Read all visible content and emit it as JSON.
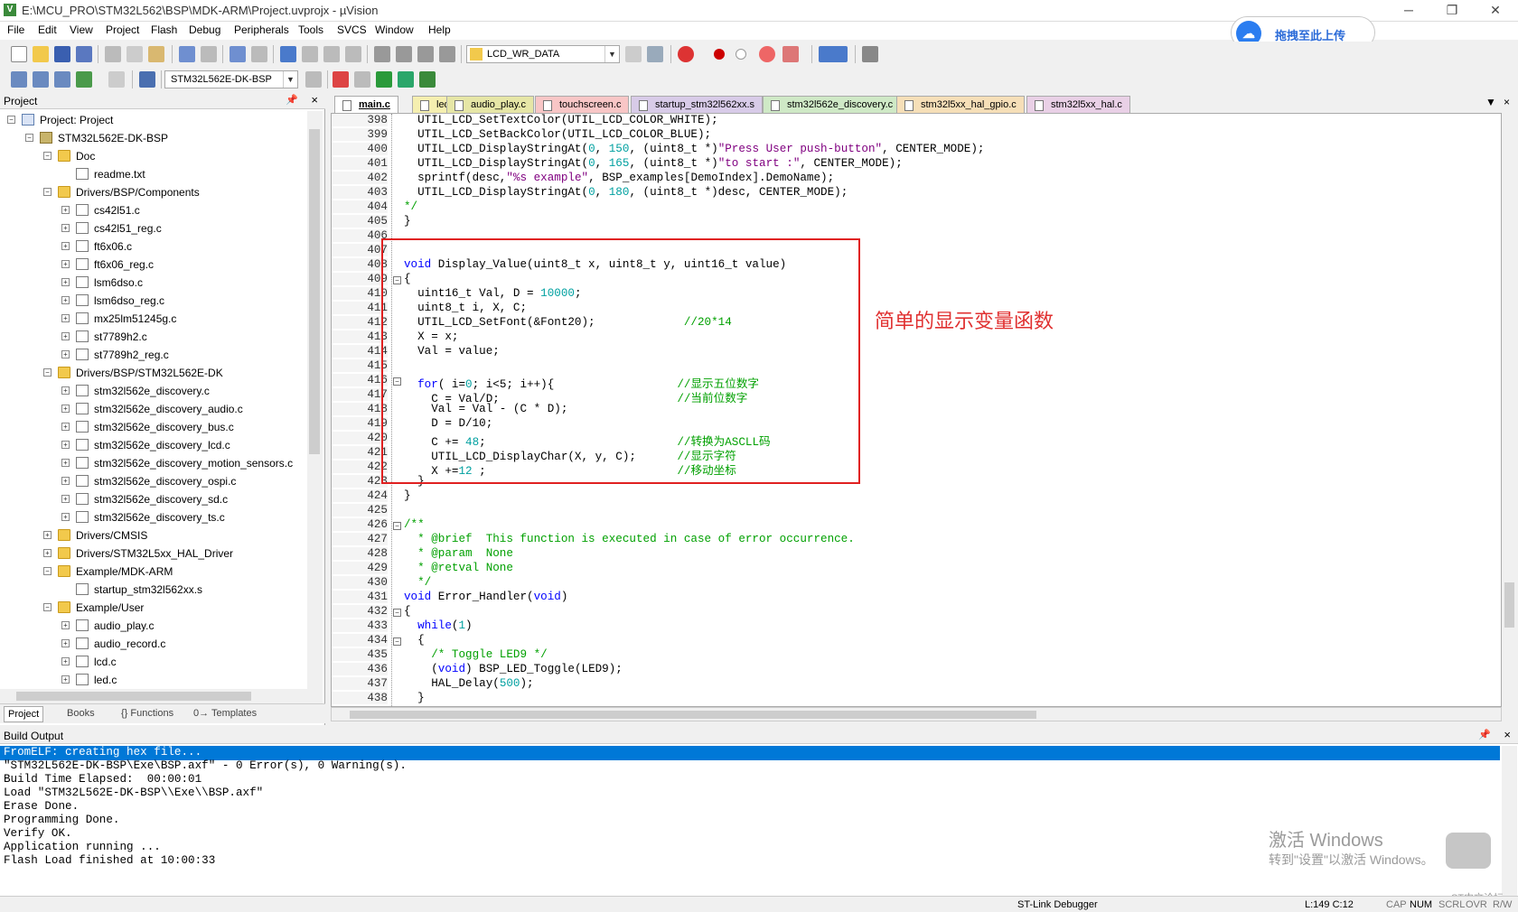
{
  "window": {
    "title": "E:\\MCU_PRO\\STM32L562\\BSP\\MDK-ARM\\Project.uvprojx - µVision",
    "icon_label": "V",
    "min": "─",
    "max": "❐",
    "close": "✕"
  },
  "menu": [
    "File",
    "Edit",
    "View",
    "Project",
    "Flash",
    "Debug",
    "Peripherals",
    "Tools",
    "SVCS",
    "Window",
    "Help"
  ],
  "baidu_button": {
    "label": "拖拽至此上传"
  },
  "toolbar1": {
    "function_combo": "LCD_WR_DATA"
  },
  "toolbar2": {
    "target_combo": "STM32L562E-DK-BSP"
  },
  "project_panel": {
    "title": "Project",
    "tree": [
      {
        "label": "Project: Project",
        "level": 0,
        "exp": "−",
        "icon": "proj"
      },
      {
        "label": "STM32L562E-DK-BSP",
        "level": 1,
        "exp": "−",
        "icon": "target"
      },
      {
        "label": "Doc",
        "level": 2,
        "exp": "−",
        "icon": "folder"
      },
      {
        "label": "readme.txt",
        "level": 3,
        "exp": "",
        "icon": "file"
      },
      {
        "label": "Drivers/BSP/Components",
        "level": 2,
        "exp": "−",
        "icon": "folder"
      },
      {
        "label": "cs42l51.c",
        "level": 3,
        "exp": "+",
        "icon": "file"
      },
      {
        "label": "cs42l51_reg.c",
        "level": 3,
        "exp": "+",
        "icon": "file"
      },
      {
        "label": "ft6x06.c",
        "level": 3,
        "exp": "+",
        "icon": "file"
      },
      {
        "label": "ft6x06_reg.c",
        "level": 3,
        "exp": "+",
        "icon": "file"
      },
      {
        "label": "lsm6dso.c",
        "level": 3,
        "exp": "+",
        "icon": "file"
      },
      {
        "label": "lsm6dso_reg.c",
        "level": 3,
        "exp": "+",
        "icon": "file"
      },
      {
        "label": "mx25lm51245g.c",
        "level": 3,
        "exp": "+",
        "icon": "file"
      },
      {
        "label": "st7789h2.c",
        "level": 3,
        "exp": "+",
        "icon": "file"
      },
      {
        "label": "st7789h2_reg.c",
        "level": 3,
        "exp": "+",
        "icon": "file"
      },
      {
        "label": "Drivers/BSP/STM32L562E-DK",
        "level": 2,
        "exp": "−",
        "icon": "folder"
      },
      {
        "label": "stm32l562e_discovery.c",
        "level": 3,
        "exp": "+",
        "icon": "file"
      },
      {
        "label": "stm32l562e_discovery_audio.c",
        "level": 3,
        "exp": "+",
        "icon": "file"
      },
      {
        "label": "stm32l562e_discovery_bus.c",
        "level": 3,
        "exp": "+",
        "icon": "file"
      },
      {
        "label": "stm32l562e_discovery_lcd.c",
        "level": 3,
        "exp": "+",
        "icon": "file"
      },
      {
        "label": "stm32l562e_discovery_motion_sensors.c",
        "level": 3,
        "exp": "+",
        "icon": "file"
      },
      {
        "label": "stm32l562e_discovery_ospi.c",
        "level": 3,
        "exp": "+",
        "icon": "file"
      },
      {
        "label": "stm32l562e_discovery_sd.c",
        "level": 3,
        "exp": "+",
        "icon": "file"
      },
      {
        "label": "stm32l562e_discovery_ts.c",
        "level": 3,
        "exp": "+",
        "icon": "file"
      },
      {
        "label": "Drivers/CMSIS",
        "level": 2,
        "exp": "+",
        "icon": "folder"
      },
      {
        "label": "Drivers/STM32L5xx_HAL_Driver",
        "level": 2,
        "exp": "+",
        "icon": "folder"
      },
      {
        "label": "Example/MDK-ARM",
        "level": 2,
        "exp": "−",
        "icon": "folder"
      },
      {
        "label": "startup_stm32l562xx.s",
        "level": 3,
        "exp": "",
        "icon": "file"
      },
      {
        "label": "Example/User",
        "level": 2,
        "exp": "−",
        "icon": "folder"
      },
      {
        "label": "audio_play.c",
        "level": 3,
        "exp": "+",
        "icon": "file"
      },
      {
        "label": "audio_record.c",
        "level": 3,
        "exp": "+",
        "icon": "file"
      },
      {
        "label": "lcd.c",
        "level": 3,
        "exp": "+",
        "icon": "file"
      },
      {
        "label": "led.c",
        "level": 3,
        "exp": "+",
        "icon": "file"
      }
    ],
    "tabs": [
      "Project",
      "Books",
      "{} Functions",
      "0→ Templates"
    ]
  },
  "editor": {
    "tabs": [
      {
        "label": "main.c",
        "color": "#ffffff",
        "active": true
      },
      {
        "label": "led.c",
        "color": "#f5efb0"
      },
      {
        "label": "audio_play.c",
        "color": "#e6e6a6"
      },
      {
        "label": "touchscreen.c",
        "color": "#f8c6c6"
      },
      {
        "label": "startup_stm32l562xx.s",
        "color": "#d8cbe8"
      },
      {
        "label": "stm32l562e_discovery.c",
        "color": "#cfe9c6"
      },
      {
        "label": "stm32l5xx_hal_gpio.c",
        "color": "#f6dfb8"
      },
      {
        "label": "stm32l5xx_hal.c",
        "color": "#e9d0e6"
      }
    ],
    "lines": [
      {
        "n": "398",
        "f": "",
        "t": "  UTIL_LCD_SetTextColor(UTIL_LCD_COLOR_WHITE);"
      },
      {
        "n": "399",
        "f": "",
        "t": "  UTIL_LCD_SetBackColor(UTIL_LCD_COLOR_BLUE);"
      },
      {
        "n": "400",
        "f": "",
        "t": "  UTIL_LCD_DisplayStringAt(0, 150, (uint8_t *)\"Press User push-button\", CENTER_MODE);"
      },
      {
        "n": "401",
        "f": "",
        "t": "  UTIL_LCD_DisplayStringAt(0, 165, (uint8_t *)\"to start :\", CENTER_MODE);"
      },
      {
        "n": "402",
        "f": "",
        "t": "  sprintf(desc,\"%s example\", BSP_examples[DemoIndex].DemoName);"
      },
      {
        "n": "403",
        "f": "",
        "t": "  UTIL_LCD_DisplayStringAt(0, 180, (uint8_t *)desc, CENTER_MODE);"
      },
      {
        "n": "404",
        "f": "end",
        "t": "*/"
      },
      {
        "n": "405",
        "f": "",
        "t": "}"
      },
      {
        "n": "406",
        "f": "",
        "t": ""
      },
      {
        "n": "407",
        "f": "",
        "t": ""
      },
      {
        "n": "408",
        "f": "",
        "t": "void Display_Value(uint8_t x, uint8_t y, uint16_t value)"
      },
      {
        "n": "409",
        "f": "−",
        "t": "{"
      },
      {
        "n": "410",
        "f": "",
        "t": "  uint16_t Val, D = 10000;"
      },
      {
        "n": "411",
        "f": "",
        "t": "  uint8_t i, X, C;"
      },
      {
        "n": "412",
        "f": "",
        "t": "  UTIL_LCD_SetFont(&Font20);             //20*14"
      },
      {
        "n": "413",
        "f": "",
        "t": "  X = x;"
      },
      {
        "n": "414",
        "f": "",
        "t": "  Val = value;"
      },
      {
        "n": "415",
        "f": "",
        "t": ""
      },
      {
        "n": "416",
        "f": "−",
        "t": "  for( i=0; i<5; i++){                  //显示五位数字"
      },
      {
        "n": "417",
        "f": "",
        "t": "    C = Val/D;                          //当前位数字"
      },
      {
        "n": "418",
        "f": "",
        "t": "    Val = Val - (C * D);"
      },
      {
        "n": "419",
        "f": "",
        "t": "    D = D/10;"
      },
      {
        "n": "420",
        "f": "",
        "t": "    C += 48;                            //转换为ASCLL码"
      },
      {
        "n": "421",
        "f": "",
        "t": "    UTIL_LCD_DisplayChar(X, y, C);      //显示字符"
      },
      {
        "n": "422",
        "f": "",
        "t": "    X +=12 ;                            //移动坐标"
      },
      {
        "n": "423",
        "f": "end",
        "t": "  }"
      },
      {
        "n": "424",
        "f": "",
        "t": "}"
      },
      {
        "n": "425",
        "f": "",
        "t": ""
      },
      {
        "n": "426",
        "f": "−",
        "t": "/**"
      },
      {
        "n": "427",
        "f": "",
        "t": "  * @brief  This function is executed in case of error occurrence."
      },
      {
        "n": "428",
        "f": "",
        "t": "  * @param  None"
      },
      {
        "n": "429",
        "f": "",
        "t": "  * @retval None"
      },
      {
        "n": "430",
        "f": "",
        "t": "  */"
      },
      {
        "n": "431",
        "f": "",
        "t": "void Error_Handler(void)"
      },
      {
        "n": "432",
        "f": "−",
        "t": "{"
      },
      {
        "n": "433",
        "f": "",
        "t": "  while(1)"
      },
      {
        "n": "434",
        "f": "−",
        "t": "  {"
      },
      {
        "n": "435",
        "f": "",
        "t": "    /* Toggle LED9 */"
      },
      {
        "n": "436",
        "f": "",
        "t": "    (void) BSP_LED_Toggle(LED9);"
      },
      {
        "n": "437",
        "f": "",
        "t": "    HAL_Delay(500);"
      },
      {
        "n": "438",
        "f": "",
        "t": "  }"
      }
    ],
    "annotation": "简单的显示变量函数"
  },
  "build_output": {
    "title": "Build Output",
    "lines": [
      "FromELF: creating hex file...",
      "\"STM32L562E-DK-BSP\\Exe\\BSP.axf\" - 0 Error(s), 0 Warning(s).",
      "Build Time Elapsed:  00:00:01",
      "Load \"STM32L562E-DK-BSP\\\\Exe\\\\BSP.axf\"",
      "Erase Done.",
      "Programming Done.",
      "Verify OK.",
      "Application running ...",
      "Flash Load finished at 10:00:33"
    ]
  },
  "watermark": {
    "line1": "激活 Windows",
    "line2": "转到\"设置\"以激活 Windows。",
    "brand": "ST中文论坛"
  },
  "status": {
    "debugger": "ST-Link Debugger",
    "position": "L:149 C:12",
    "cap": "CAP",
    "num": "NUM",
    "scrl": "SCRL",
    "ovr": "OVR",
    "rw": "R/W"
  }
}
